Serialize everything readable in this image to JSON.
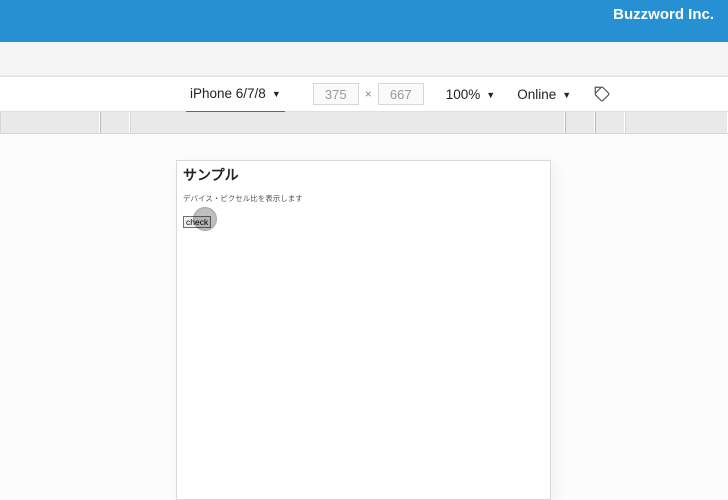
{
  "header": {
    "brand": "Buzzword Inc."
  },
  "toolbar": {
    "device_label": "iPhone 6/7/8",
    "width": "375",
    "height": "667",
    "zoom_label": "100%",
    "network_label": "Online"
  },
  "page": {
    "heading": "サンプル",
    "subtext": "デバイス・ピクセル比を表示します",
    "button_label": "check"
  }
}
